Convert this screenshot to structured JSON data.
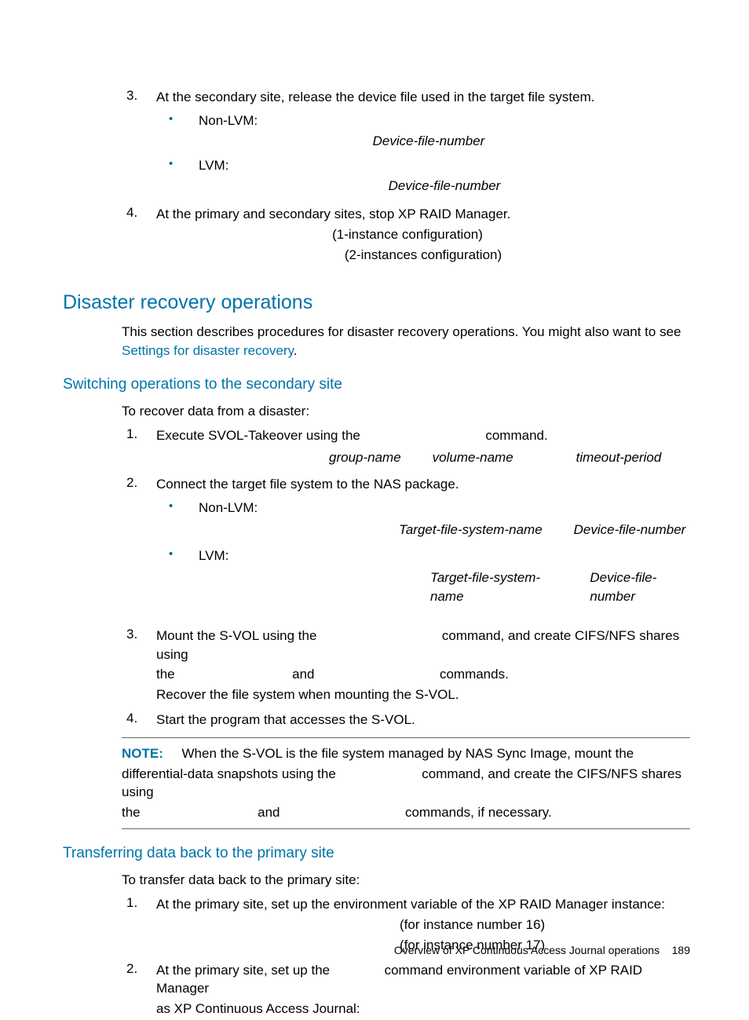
{
  "step3": {
    "num": "3.",
    "text": "At the secondary site, release the device file used in the target file system.",
    "b1_label": "Non-LVM:",
    "b1_detail": "Device-file-number",
    "b2_label": "LVM:",
    "b2_detail": "Device-file-number"
  },
  "step4": {
    "num": "4.",
    "text": "At the primary and secondary sites, stop XP RAID Manager.",
    "d1": "(1-instance configuration)",
    "d2": "(2-instances configuration)"
  },
  "disaster": {
    "heading": "Disaster recovery operations",
    "intro_a": "This section describes procedures for disaster recovery operations. You might also want to see ",
    "intro_link": "Settings for disaster recovery",
    "intro_b": "."
  },
  "switch": {
    "heading": "Switching operations to the secondary site",
    "intro": "To recover data from a disaster:",
    "s1": {
      "num": "1.",
      "a": "Execute SVOL-Takeover using the",
      "b": "command.",
      "p1": "group-name",
      "p2": "volume-name",
      "p3": "timeout-period"
    },
    "s2": {
      "num": "2.",
      "text": "Connect the target file system to the NAS package.",
      "b1_label": "Non-LVM:",
      "b1_p1": "Target-file-system-name",
      "b1_p2": "Device-file-number",
      "b2_label": "LVM:",
      "b2_p1": "Target-file-system-name",
      "b2_p2": "Device-file-number"
    },
    "s3": {
      "num": "3.",
      "a": "Mount the S-VOL using the",
      "b": "command, and create CIFS/NFS shares using",
      "c": "the",
      "d": "and",
      "e": "commands.",
      "f": "Recover the file system when mounting the S-VOL."
    },
    "s4": {
      "num": "4.",
      "text": "Start the program that accesses the S-VOL."
    },
    "note": {
      "label": "NOTE:",
      "a": "When the S-VOL is the file system managed by NAS Sync Image, mount the",
      "b": "differential-data snapshots using the",
      "c": "command, and create the CIFS/NFS shares using",
      "d": "the",
      "e": "and",
      "f": "commands, if necessary."
    }
  },
  "transfer": {
    "heading": "Transferring data back to the primary site",
    "intro": "To transfer data back to the primary site:",
    "s1": {
      "num": "1.",
      "text": "At the primary site, set up the environment variable of the XP RAID Manager instance:",
      "d1": "(for instance number 16)",
      "d2": "(for instance number 17)"
    },
    "s2": {
      "num": "2.",
      "a": "At the primary site, set up the",
      "b": "command environment variable of XP RAID Manager",
      "c": "as XP Continuous Access Journal:"
    }
  },
  "footer": {
    "text": "Overview of XP Continuous Access Journal operations",
    "page": "189"
  }
}
